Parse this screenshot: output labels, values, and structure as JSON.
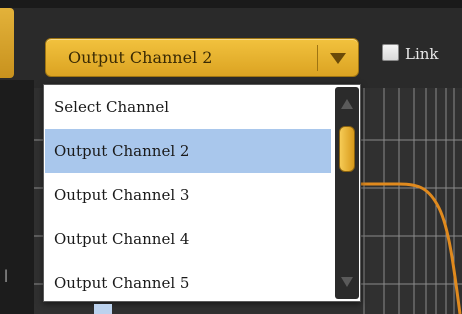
{
  "channel_select": {
    "value": "Output Channel 2",
    "arrow_icon": "triangle-down-icon"
  },
  "link": {
    "label": "Link",
    "checked": false
  },
  "dropdown": {
    "options": [
      {
        "label": "Select Channel",
        "selected": false
      },
      {
        "label": "Output Channel 2",
        "selected": true
      },
      {
        "label": "Output Channel 3",
        "selected": false
      },
      {
        "label": "Output Channel 4",
        "selected": false
      },
      {
        "label": "Output Channel 5",
        "selected": false
      }
    ]
  },
  "colors": {
    "accent": "#e8b22d",
    "selected_row": "#a9c7ec",
    "curve": "#e08a1e"
  }
}
